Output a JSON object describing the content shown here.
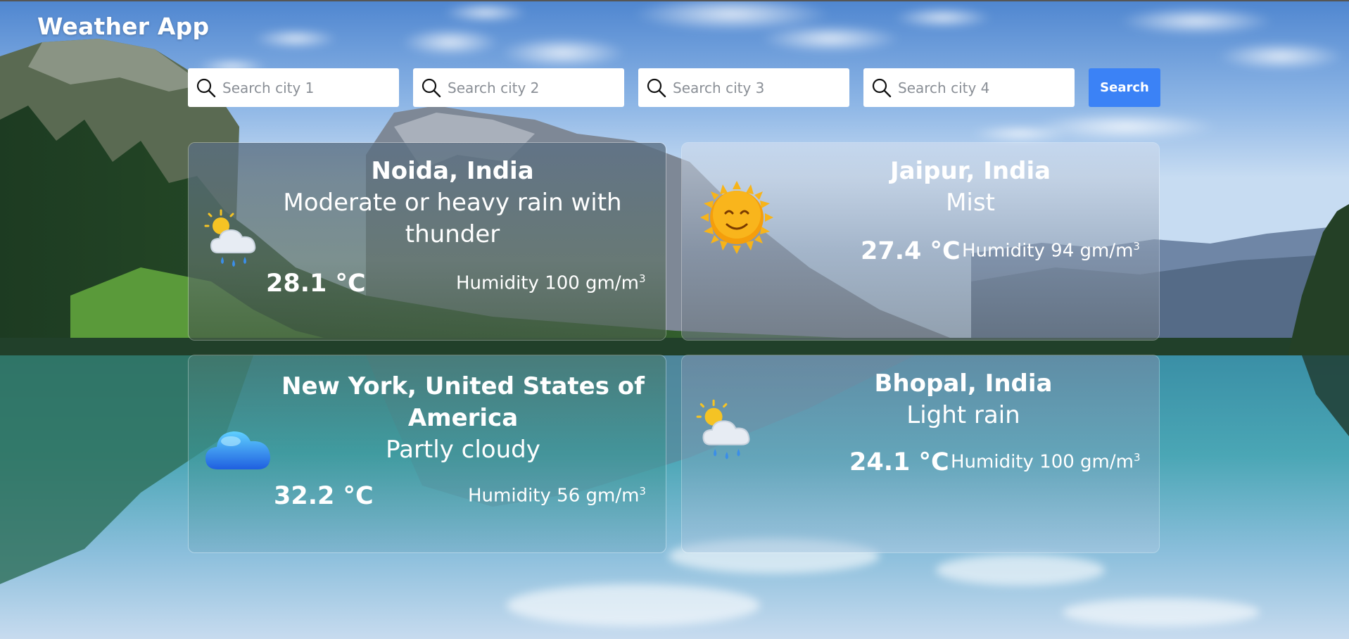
{
  "app": {
    "title": "Weather App"
  },
  "search": {
    "fields": [
      {
        "placeholder": "Search city 1",
        "value": ""
      },
      {
        "placeholder": "Search city 2",
        "value": ""
      },
      {
        "placeholder": "Search city 3",
        "value": ""
      },
      {
        "placeholder": "Search city 4",
        "value": ""
      }
    ],
    "button_label": "Search",
    "icon": "search-icon"
  },
  "cards": [
    {
      "city": "Noida, India",
      "condition": "Moderate or heavy rain with thunder",
      "temperature": "28.1 °C",
      "humidity_label": "Humidity 100 gm/m",
      "humidity_sup": "3",
      "icon": "rain-cloud-sun-icon"
    },
    {
      "city": "Jaipur, India",
      "condition": "Mist",
      "temperature": "27.4 °C",
      "humidity_label": "Humidity 94 gm/m",
      "humidity_sup": "3",
      "icon": "sun-icon"
    },
    {
      "city": "New York, United States of America",
      "condition": "Partly cloudy",
      "temperature": "32.2 °C",
      "humidity_label": "Humidity 56 gm/m",
      "humidity_sup": "3",
      "icon": "cloud-icon"
    },
    {
      "city": "Bhopal, India",
      "condition": "Light rain",
      "temperature": "24.1 °C",
      "humidity_label": "Humidity 100 gm/m",
      "humidity_sup": "3",
      "icon": "rain-cloud-sun-icon"
    }
  ],
  "colors": {
    "search_button": "#3b82f6",
    "card_text": "#ffffff",
    "input_bg": "#ffffff"
  }
}
